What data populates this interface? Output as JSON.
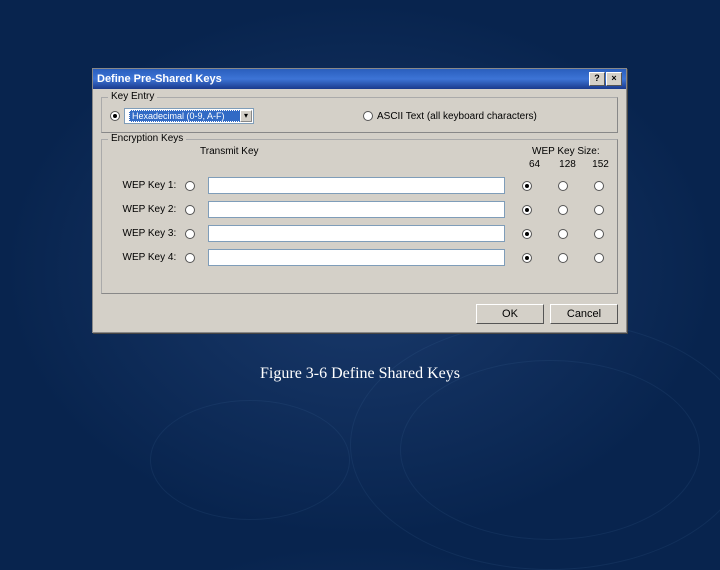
{
  "titlebar": {
    "title": "Define Pre-Shared Keys",
    "help": "?",
    "close": "×"
  },
  "keyEntry": {
    "groupLabel": "Key Entry",
    "hexLabel": "Hexadecimal (0-9, A-F)",
    "asciiLabel": "ASCII Text (all keyboard characters)"
  },
  "encKeys": {
    "groupLabel": "Encryption Keys",
    "transmitHeader": "Transmit Key",
    "sizeHeader": "WEP Key Size:",
    "sizes": {
      "s64": "64",
      "s128": "128",
      "s152": "152"
    },
    "rows": [
      {
        "label": "WEP Key 1:",
        "value": ""
      },
      {
        "label": "WEP Key 2:",
        "value": ""
      },
      {
        "label": "WEP Key 3:",
        "value": ""
      },
      {
        "label": "WEP Key 4:",
        "value": ""
      }
    ]
  },
  "buttons": {
    "ok": "OK",
    "cancel": "Cancel"
  },
  "caption": "Figure 3-6 Define Shared Keys"
}
